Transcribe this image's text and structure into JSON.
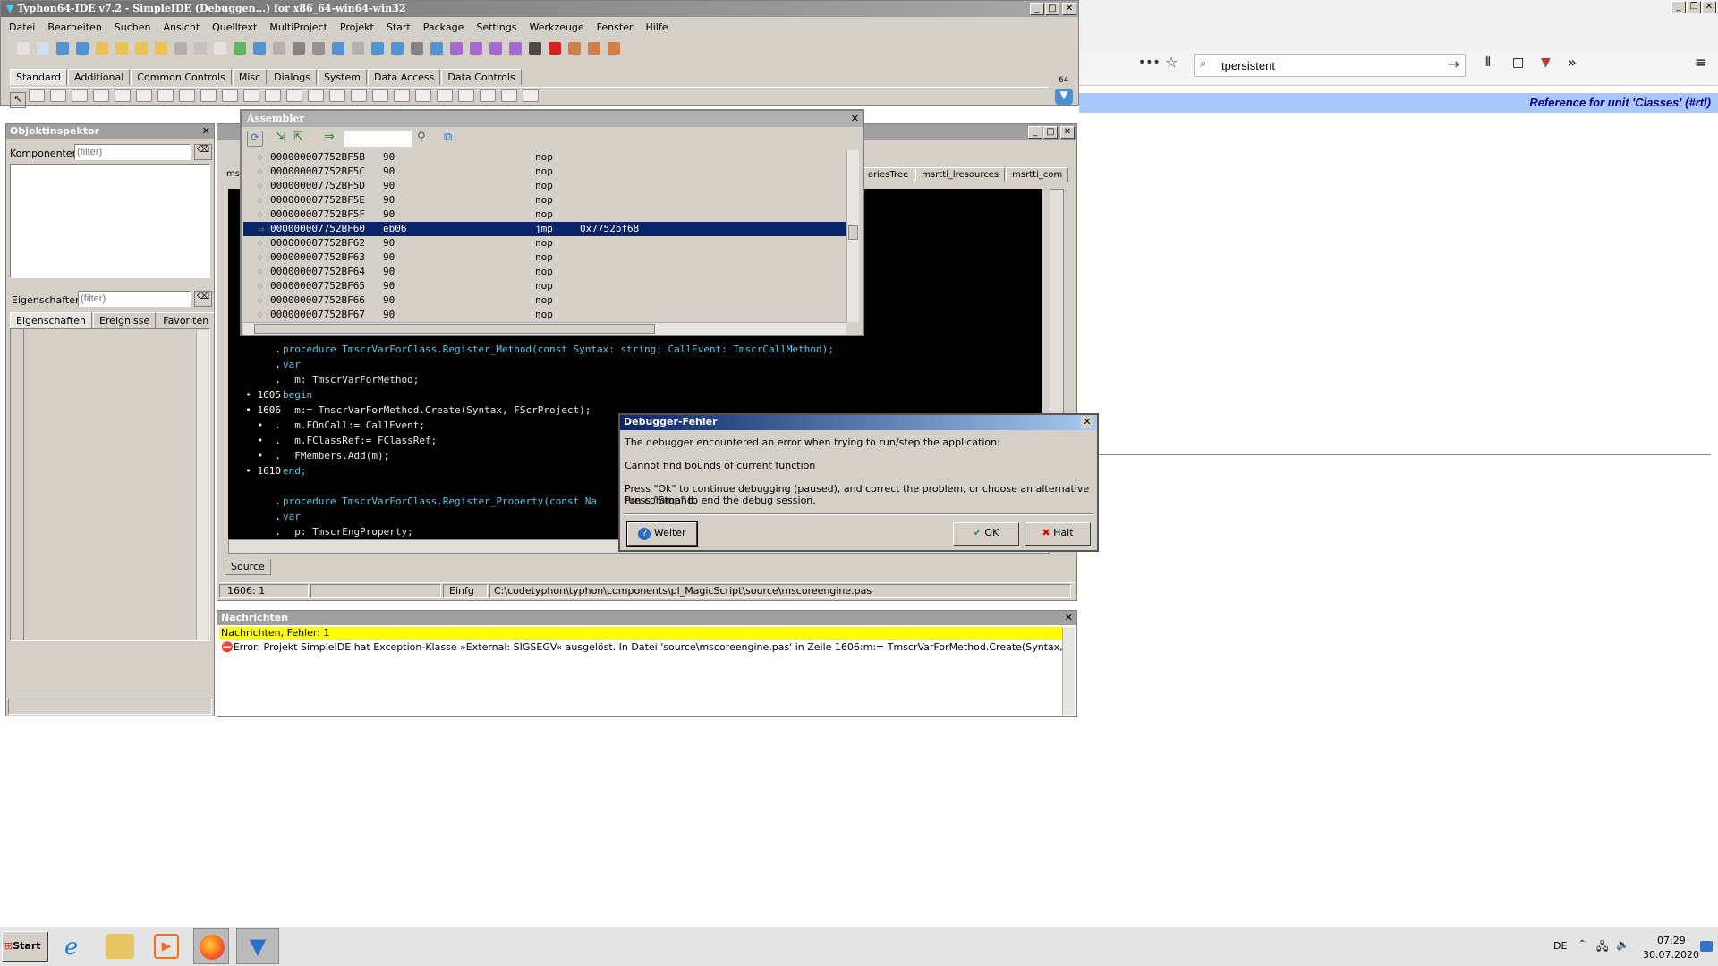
{
  "ide": {
    "title": "Typhon64-IDE v7.2 - SimpleIDE (Debuggen...) for x86_64-win64-win32",
    "menu": [
      "Datei",
      "Bearbeiten",
      "Suchen",
      "Ansicht",
      "Quelltext",
      "MultiProject",
      "Projekt",
      "Start",
      "Package",
      "Settings",
      "Werkzeuge",
      "Fenster",
      "Hilfe"
    ],
    "palette_tabs": [
      "Standard",
      "Additional",
      "Common Controls",
      "Misc",
      "Dialogs",
      "System",
      "Data Access",
      "Data Controls"
    ],
    "badge": "64"
  },
  "inspector": {
    "title": "Objektinspektor",
    "components_label": "Komponenten",
    "components_placeholder": "(filter)",
    "props_label": "Eigenschaften",
    "props_placeholder": "(filter)",
    "tabs": [
      "Eigenschaften",
      "Ereignisse",
      "Favoriten"
    ]
  },
  "assembler": {
    "title": "Assembler",
    "rows": [
      {
        "addr": "000000007752BF5B",
        "hex": "90",
        "op": "nop",
        "arg": ""
      },
      {
        "addr": "000000007752BF5C",
        "hex": "90",
        "op": "nop",
        "arg": ""
      },
      {
        "addr": "000000007752BF5D",
        "hex": "90",
        "op": "nop",
        "arg": ""
      },
      {
        "addr": "000000007752BF5E",
        "hex": "90",
        "op": "nop",
        "arg": ""
      },
      {
        "addr": "000000007752BF5F",
        "hex": "90",
        "op": "nop",
        "arg": ""
      },
      {
        "addr": "000000007752BF60",
        "hex": "eb06",
        "op": "jmp",
        "arg": "0x7752bf68"
      },
      {
        "addr": "000000007752BF62",
        "hex": "90",
        "op": "nop",
        "arg": ""
      },
      {
        "addr": "000000007752BF63",
        "hex": "90",
        "op": "nop",
        "arg": ""
      },
      {
        "addr": "000000007752BF64",
        "hex": "90",
        "op": "nop",
        "arg": ""
      },
      {
        "addr": "000000007752BF65",
        "hex": "90",
        "op": "nop",
        "arg": ""
      },
      {
        "addr": "000000007752BF66",
        "hex": "90",
        "op": "nop",
        "arg": ""
      },
      {
        "addr": "000000007752BF67",
        "hex": "90",
        "op": "nop",
        "arg": ""
      }
    ]
  },
  "editor": {
    "tabs_right": [
      "ariesTree",
      "msrtti_lresources",
      "msrtti_com"
    ],
    "tab_left": "ms",
    "gutter": [
      ".",
      ".",
      ".",
      "• 1605",
      "• 1606",
      "•  .",
      "•  .",
      "•  .",
      "• 1610",
      "",
      ".",
      ".",
      "."
    ],
    "lines": [
      "procedure TmscrVarForClass.Register_Method(const Syntax: string; CallEvent: TmscrCallMethod);",
      "var",
      "  m: TmscrVarForMethod;",
      "begin",
      "  m:= TmscrVarForMethod.Create(Syntax, FScrProject);",
      "  m.FOnCall:= CallEvent;",
      "  m.FClassRef:= FClassRef;",
      "  FMembers.Add(m);",
      "end;",
      "",
      "procedure TmscrVarForClass.Register_Property(const Na",
      "var",
      "  p: TmscrEngProperty;"
    ],
    "bottom_tab": "Source",
    "status_pos": "1606:  1",
    "status_mode": "Einfg",
    "status_path": "C:\\codetyphon\\typhon\\components\\pl_MagicScript\\source\\mscoreengine.pas"
  },
  "messages": {
    "title": "Nachrichten",
    "header": "Nachrichten, Fehler: 1",
    "error": "Error: Projekt SimpleIDE hat Exception-Klasse »External: SIGSEGV« ausgelöst. In Datei 'source\\mscoreengine.pas' in Zeile 1606:m:= TmscrVarForMethod.Create(Syntax, FScrProject);"
  },
  "dialog": {
    "title": "Debugger-Fehler",
    "line1": "The debugger encountered an error when trying to run/step the application:",
    "line2": "Cannot find bounds of current function",
    "line3": "Press \"Ok\" to continue debugging (paused), and correct the problem, or choose an alternative run command.",
    "line4": "Press \"Stop\" to end the debug session.",
    "btn_continue": "Weiter",
    "btn_ok": "OK",
    "btn_stop": "Halt"
  },
  "browser": {
    "search_value": "tpersistent",
    "ref_text": "Reference for unit 'Classes' (#rtl)",
    "dots": "•••"
  },
  "taskbar": {
    "start": "Start",
    "lang": "DE",
    "time": "07:29",
    "date": "30.07.2020"
  }
}
